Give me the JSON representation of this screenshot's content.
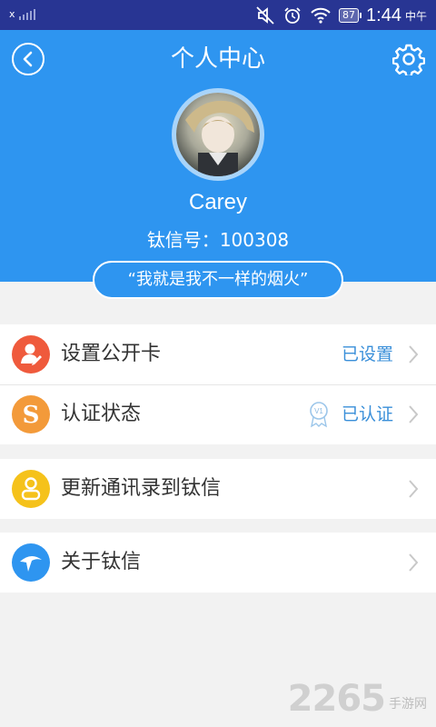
{
  "status_bar": {
    "time": "1:44",
    "period": "中午",
    "battery": "87",
    "signal_label": "x"
  },
  "header": {
    "title": "个人中心",
    "username": "Carey",
    "id_label": "钛信号：",
    "id_value": "100308",
    "signature": "“我就是我不一样的烟火”",
    "bg_color": "#2e95f0"
  },
  "menu": {
    "group1": [
      {
        "label": "设置公开卡",
        "value": "已设置",
        "icon": "public-card-icon",
        "icon_color": "#ef5a3c"
      },
      {
        "label": "认证状态",
        "value": "已认证",
        "icon": "s-certify-icon",
        "icon_color": "#f39a3a",
        "badge": "V1"
      }
    ],
    "group2": [
      {
        "label": "更新通讯录到钛信",
        "icon": "contact-person-icon",
        "icon_color": "#f5c21b"
      }
    ],
    "group3": [
      {
        "label": "关于钛信",
        "icon": "titanium-logo-icon",
        "icon_color": "#2e95f0"
      }
    ]
  },
  "watermark": {
    "number": "2265",
    "text": "手游网"
  }
}
